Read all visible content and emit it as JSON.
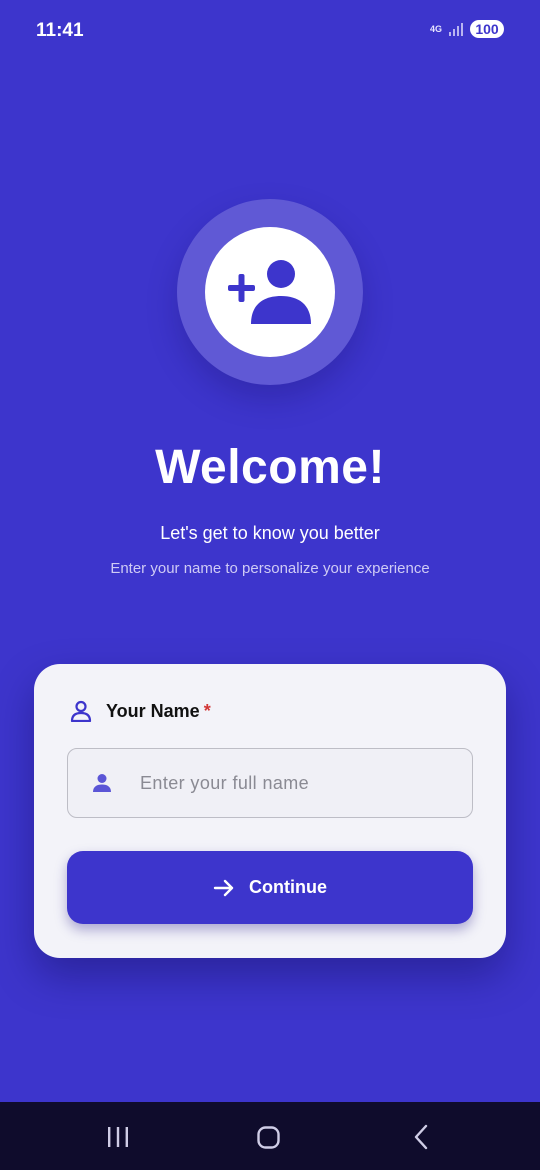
{
  "status_bar": {
    "time": "11:41",
    "network": "4G",
    "battery": "100"
  },
  "hero": {
    "icon": "add-person-icon",
    "title": "Welcome!",
    "subtitle": "Let's get to know you better",
    "description": "Enter your name to personalize your experience"
  },
  "form": {
    "label": "Your Name",
    "required_mark": "*",
    "name_placeholder": "Enter your full name",
    "name_value": "",
    "continue_label": "Continue"
  },
  "colors": {
    "accent": "#3d35cc",
    "card": "#f3f3f9",
    "required": "#d23636",
    "nav_bar": "#0f0c2c"
  },
  "nav": {
    "icons": [
      "recent-apps-icon",
      "home-icon",
      "back-icon"
    ]
  }
}
